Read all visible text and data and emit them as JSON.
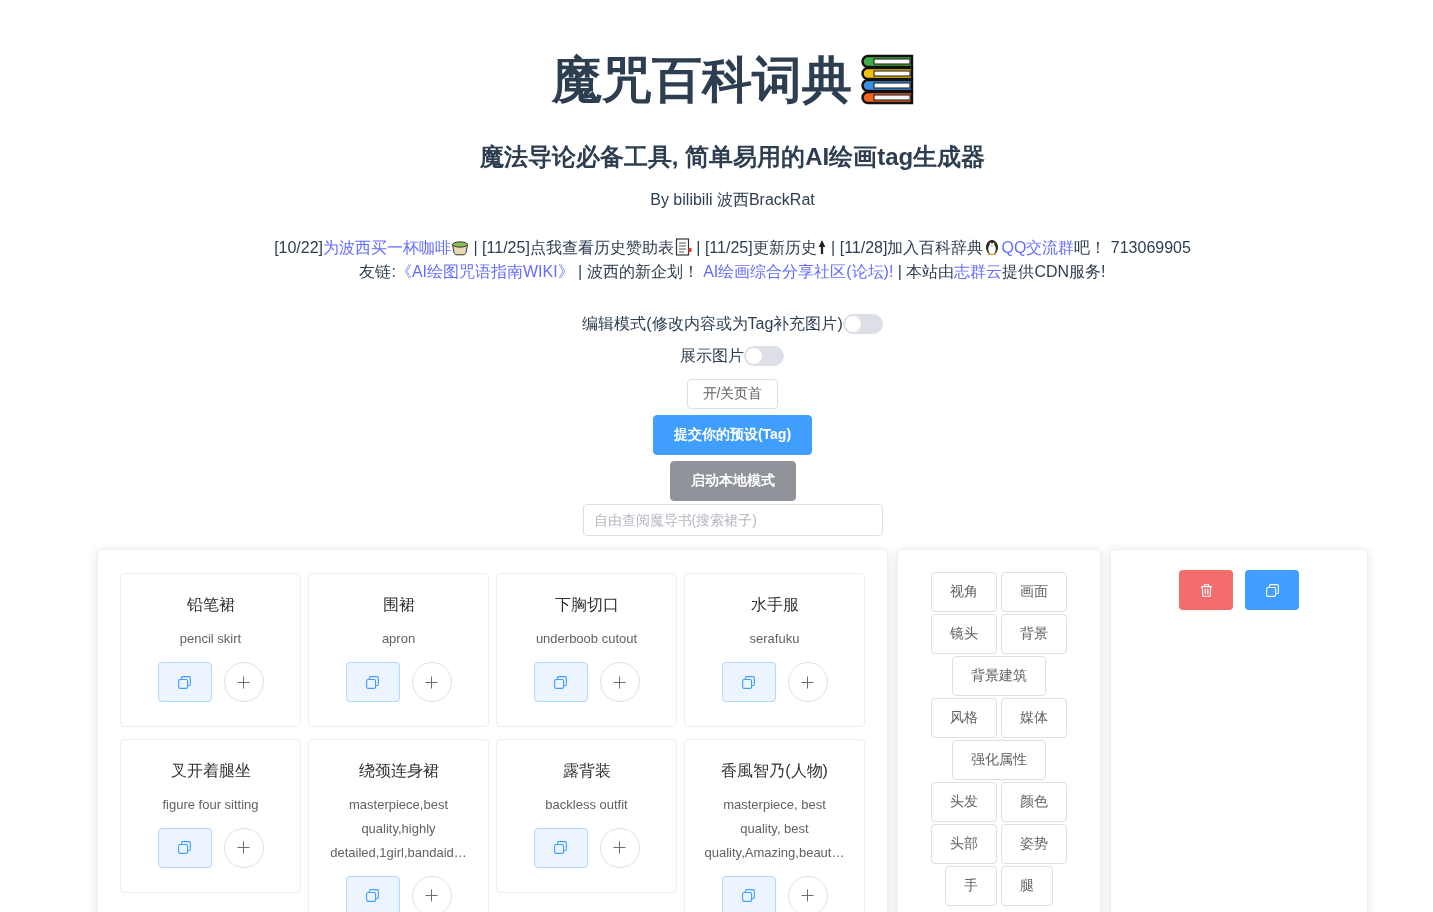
{
  "header": {
    "title": "魔咒百科词典",
    "subtitle": "魔法导论必备工具, 简单易用的AI绘画tag生成器",
    "byline": "By bilibili 波西BrackRat"
  },
  "notices": [
    [
      {
        "kind": "text",
        "text": "[10/22]"
      },
      {
        "kind": "link",
        "text": "为波西买一杯咖啡"
      },
      {
        "kind": "text",
        "text": " | [11/25]点我查看历史赞助表"
      },
      {
        "kind": "text",
        "text": " | [11/25]更新历史"
      },
      {
        "kind": "text",
        "text": " | [11/28]加入百科辞典"
      },
      {
        "kind": "link",
        "text": "QQ交流群"
      },
      {
        "kind": "text",
        "text": "吧！ 713069905"
      }
    ],
    [
      {
        "kind": "text",
        "text": "友链:"
      },
      {
        "kind": "link",
        "text": "《AI绘图咒语指南WIKI》"
      },
      {
        "kind": "text",
        "text": " | 波西的新企划！ "
      },
      {
        "kind": "link",
        "text": "AI绘画综合分享社区(论坛)!"
      },
      {
        "kind": "text",
        "text": " | 本站由"
      },
      {
        "kind": "link",
        "text": "志群云"
      },
      {
        "kind": "text",
        "text": "提供CDN服务!"
      }
    ]
  ],
  "settings": [
    {
      "label": "编辑模式(修改内容或为Tag补充图片)",
      "on": false
    },
    {
      "label": "展示图片",
      "on": false
    }
  ],
  "actions": [
    {
      "label": "开/关页首",
      "kind": "outline"
    },
    {
      "label": "提交你的预设(Tag)",
      "kind": "primary"
    },
    {
      "label": "启动本地模式",
      "kind": "info"
    }
  ],
  "search": {
    "placeholder": "自由查阅魔导书(搜索裙子)"
  },
  "tag_cards": [
    {
      "name": "铅笔裙",
      "tag": "pencil skirt"
    },
    {
      "name": "围裙",
      "tag": "apron"
    },
    {
      "name": "下胸切口",
      "tag": "underboob cutout"
    },
    {
      "name": "水手服",
      "tag": "serafuku"
    },
    {
      "name": "叉开着腿坐",
      "tag": "figure four sitting"
    },
    {
      "name": "绕颈连身裙",
      "tag": "masterpiece,best quality,highly detailed,1girl,bandaid…"
    },
    {
      "name": "露背装",
      "tag": "backless outfit"
    },
    {
      "name": "香風智乃(人物)",
      "tag": "masterpiece, best quality, best quality,Amazing,beaut…"
    }
  ],
  "categories": [
    "视角",
    "画面",
    "镜头",
    "背景",
    "背景建筑",
    "风格",
    "媒体",
    "强化属性",
    "头发",
    "颜色",
    "头部",
    "姿势",
    "手",
    "腿"
  ],
  "preset_panel": {
    "buttons": [
      {
        "kind": "delete"
      },
      {
        "kind": "copy"
      }
    ]
  }
}
